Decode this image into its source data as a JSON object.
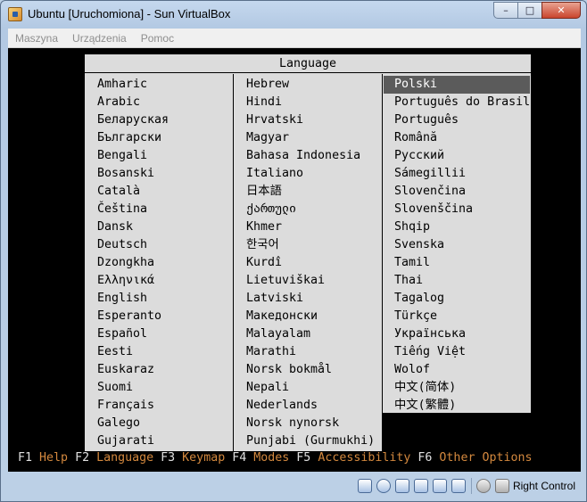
{
  "window": {
    "title": "Ubuntu [Uruchomiona] - Sun VirtualBox",
    "minimize": "–",
    "maximize": "□",
    "close": "✕"
  },
  "menubar": [
    "Maszyna",
    "Urządzenia",
    "Pomoc"
  ],
  "dialog": {
    "title": "Language",
    "selected": "Polski",
    "columns": [
      [
        "Amharic",
        "Arabic",
        "Беларуская",
        "Български",
        "Bengali",
        "Bosanski",
        "Català",
        "Čeština",
        "Dansk",
        "Deutsch",
        "Dzongkha",
        "Ελληνικά",
        "English",
        "Esperanto",
        "Español",
        "Eesti",
        "Euskaraz",
        "Suomi",
        "Français",
        "Galego",
        "Gujarati"
      ],
      [
        "Hebrew",
        "Hindi",
        "Hrvatski",
        "Magyar",
        "Bahasa Indonesia",
        "Italiano",
        "日本語",
        "ქართული",
        "Khmer",
        "한국어",
        "Kurdî",
        "Lietuviškai",
        "Latviski",
        "Македонски",
        "Malayalam",
        "Marathi",
        "Norsk bokmål",
        "Nepali",
        "Nederlands",
        "Norsk nynorsk",
        "Punjabi (Gurmukhi)"
      ],
      [
        "Polski",
        "Português do Brasil",
        "Português",
        "Română",
        "Русский",
        "Sámegillii",
        "Slovenčina",
        "Slovenščina",
        "Shqip",
        "Svenska",
        "Tamil",
        "Thai",
        "Tagalog",
        "Türkçe",
        "Українська",
        "Tiếng Việt",
        "Wolof",
        "中文(简体)",
        "中文(繁體)"
      ]
    ]
  },
  "fkeys": [
    {
      "key": "F1",
      "label": "Help"
    },
    {
      "key": "F2",
      "label": "Language"
    },
    {
      "key": "F3",
      "label": "Keymap"
    },
    {
      "key": "F4",
      "label": "Modes"
    },
    {
      "key": "F5",
      "label": "Accessibility"
    },
    {
      "key": "F6",
      "label": "Other Options"
    }
  ],
  "statusbar": {
    "icons": [
      "hard-disk-icon",
      "cd-icon",
      "floppy-icon",
      "usb-icon",
      "shared-folder-icon",
      "network-icon",
      "mouse-integration-icon",
      "host-key-icon"
    ],
    "host_key": "Right Control"
  }
}
